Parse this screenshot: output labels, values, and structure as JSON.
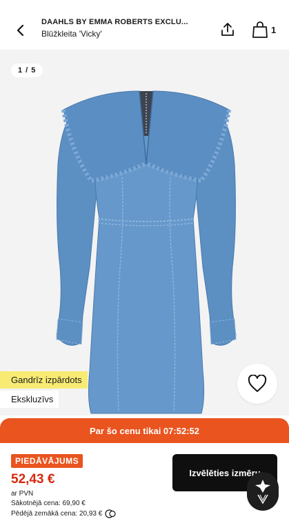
{
  "header": {
    "brand": "DAAHLS BY EMMA ROBERTS EXCLU...",
    "product_name": "Blūžkleita 'Vicky'",
    "cart_count": "1",
    "icons": [
      "chevron-left-icon",
      "share-icon",
      "shopping-bag-icon"
    ]
  },
  "gallery": {
    "counter": "1 / 5",
    "image": "denim-dress",
    "tags": {
      "almost_sold_out": "Gandrīz izpārdots",
      "exclusive": "Ekskluzīvs"
    },
    "wishlist_icon": "heart-icon"
  },
  "countdown": {
    "text": "Par šo cenu tikai 07:52:52"
  },
  "pricing": {
    "offer_badge": "PIEDĀVĀJUMS",
    "price": "52,43 €",
    "vat": "ar PVN",
    "original_price": "Sākotnējā cena: 69,90 €",
    "lowest_price": "Pēdējā zemākā cena: 20,93 €",
    "info_icon": "info-icon"
  },
  "actions": {
    "choose_size": "Izvēlēties izmēru"
  },
  "colors": {
    "accent_orange": "#e9541f",
    "price_red": "#d6290f",
    "tag_yellow": "#f7eb73",
    "button_black": "#0f0f0f"
  }
}
